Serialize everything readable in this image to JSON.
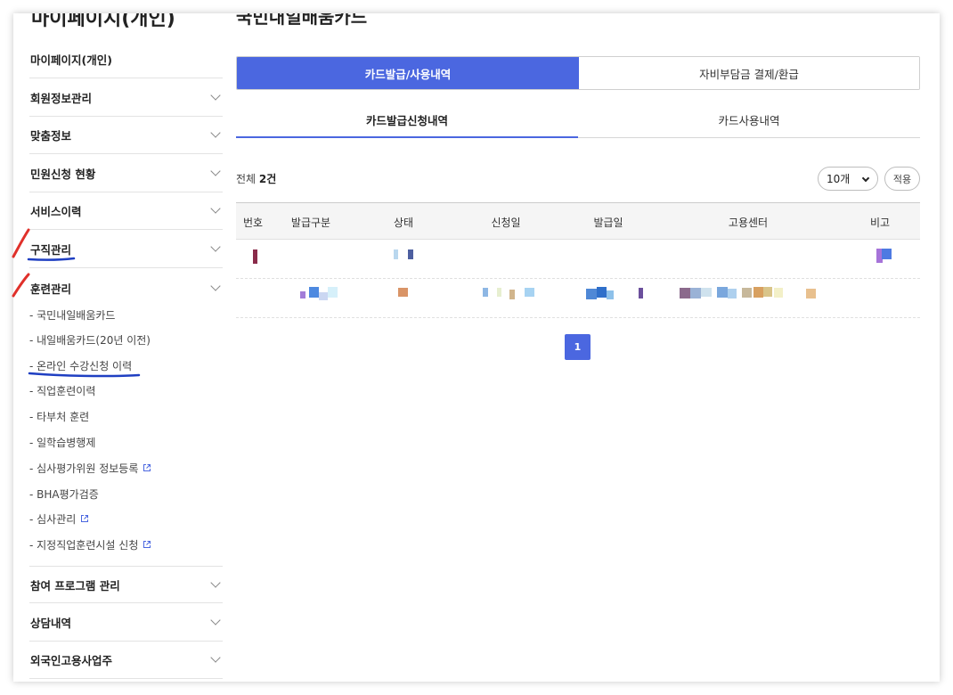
{
  "sidebar": {
    "title": "마이페이지(개인)",
    "sections": [
      {
        "label": "마이페이지(개인)"
      },
      {
        "label": "회원정보관리"
      },
      {
        "label": "맞춤정보"
      },
      {
        "label": "민원신청 현황"
      },
      {
        "label": "서비스이력"
      },
      {
        "label": "구직관리"
      },
      {
        "label": "훈련관리"
      }
    ],
    "training_items": [
      {
        "label": "- 국민내일배움카드"
      },
      {
        "label": "- 내일배움카드(20년 이전)"
      },
      {
        "label": "- 온라인 수강신청 이력"
      },
      {
        "label": "- 직업훈련이력"
      },
      {
        "label": "- 타부처 훈련"
      },
      {
        "label": "- 일학습병행제"
      },
      {
        "label": "- 심사평가위원 정보등록"
      },
      {
        "label": "- BHA평가검증"
      },
      {
        "label": "- 심사관리"
      },
      {
        "label": "- 지정직업훈련시설 신청"
      }
    ],
    "bottom_sections": [
      {
        "label": "참여 프로그램 관리"
      },
      {
        "label": "상담내역"
      },
      {
        "label": "외국인고용사업주"
      }
    ]
  },
  "main": {
    "title": "국민내일배움카드",
    "tabs": [
      {
        "label": "카드발급/사용내역"
      },
      {
        "label": "자비부담금 결제/환급"
      }
    ],
    "subtabs": [
      {
        "label": "카드발급신청내역"
      },
      {
        "label": "카드사용내역"
      }
    ],
    "total_prefix": "전체",
    "total_count": "2건",
    "page_size": "10개",
    "apply_label": "적용",
    "columns": [
      "번호",
      "발급구분",
      "상태",
      "신청일",
      "발급일",
      "고용센터",
      "비고"
    ],
    "page": "1"
  },
  "colors": {
    "accent": "#4b67e0",
    "annotation_red": "#e0302a",
    "annotation_blue": "#1f3fc2"
  }
}
